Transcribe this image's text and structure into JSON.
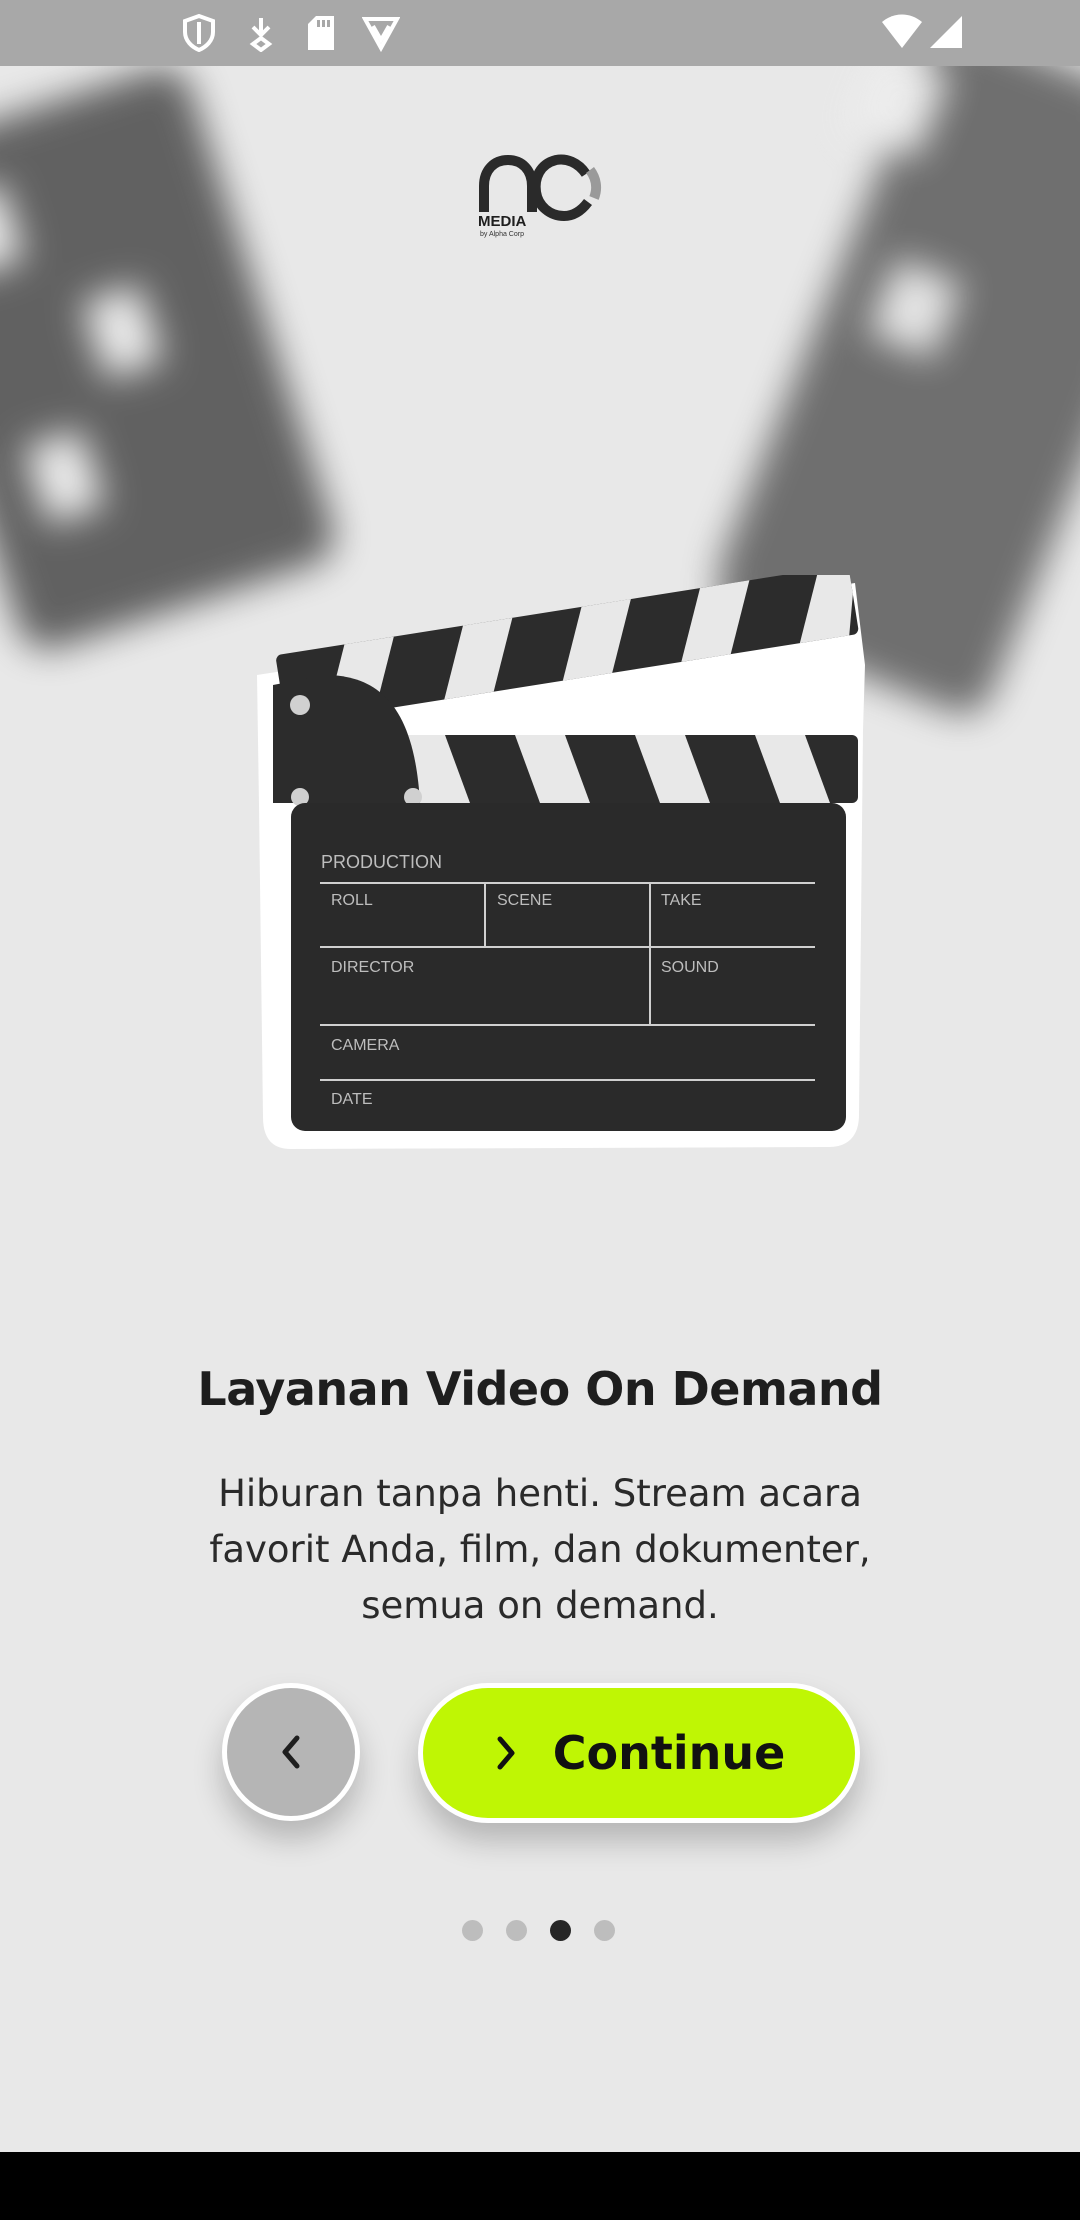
{
  "status_bar": {
    "icons": [
      "shield-icon",
      "download-icon",
      "sd-card-icon",
      "vpn-shield-icon",
      "wifi-icon",
      "signal-icon"
    ]
  },
  "logo": {
    "brand": "MEDIA",
    "tagline": "by Alpha Corp"
  },
  "clapperboard": {
    "fields": {
      "production": "PRODUCTION",
      "roll": "ROLL",
      "scene": "SCENE",
      "take": "TAKE",
      "director": "DIRECTOR",
      "sound": "SOUND",
      "camera": "CAMERA",
      "date": "DATE"
    }
  },
  "onboarding": {
    "title": "Layanan Video On Demand",
    "description": "Hiburan tanpa henti. Stream acara favorit Anda, film, dan dokumenter, semua on demand.",
    "back_icon": "chevron-left-icon",
    "continue_icon": "chevron-right-icon",
    "continue_label": "Continue",
    "pages": 4,
    "current_page": 3
  },
  "colors": {
    "accent": "#bff604",
    "background": "#e8e8e8",
    "status_bar": "#a8a8a8",
    "back_button": "#b5b5b5",
    "dot_active": "#262626",
    "dot_inactive": "#bdbdbd"
  }
}
